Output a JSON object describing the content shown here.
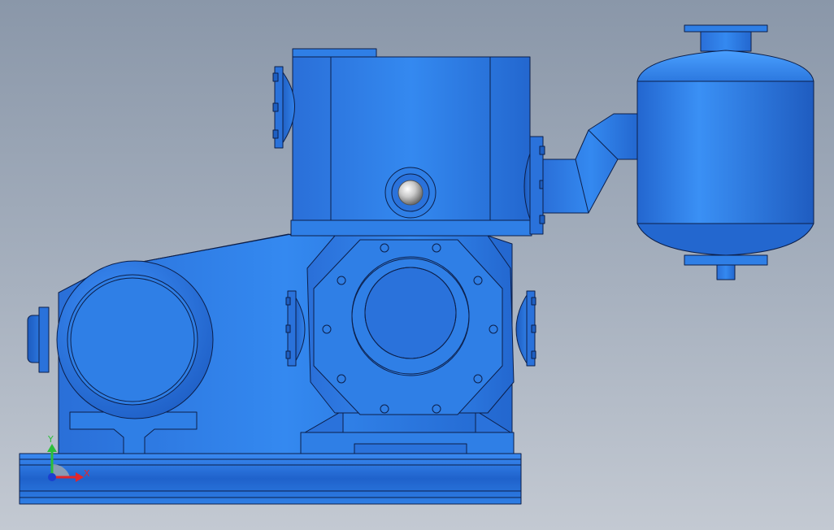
{
  "viewport": {
    "background_top": "#8a97a9",
    "background_bottom": "#c3c9d2"
  },
  "model": {
    "body_color": "#2f7fe6",
    "shade_color": "#1e5fc2",
    "outline_color": "#0c1f4a"
  },
  "triad": {
    "x_label": "X",
    "y_label": "Y",
    "x_color": "#e2262b",
    "y_color": "#2bbf3a",
    "z_color": "#1a3fd0"
  }
}
